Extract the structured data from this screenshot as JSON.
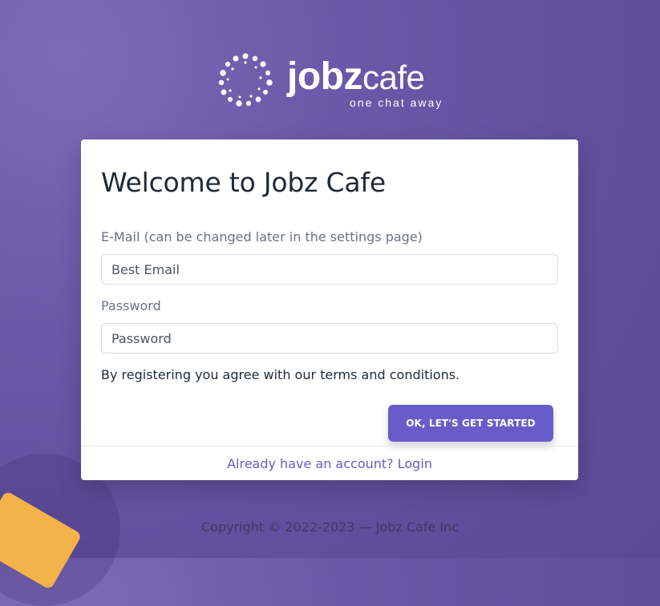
{
  "brand": {
    "name_strong": "jobz",
    "name_light": "cafe",
    "tagline": "one chat away",
    "color_white": "#ffffff"
  },
  "register": {
    "title": "Welcome to Jobz Cafe",
    "email_label": "E-Mail (can be changed later in the settings page)",
    "email_placeholder": "Best Email",
    "password_label": "Password",
    "password_placeholder": "Password",
    "terms_text": "By registering you agree with our terms and conditions.",
    "submit_label": "OK, LET'S GET STARTED",
    "login_link_label": "Already have an account? Login",
    "accent_color": "#6a5cc8"
  },
  "footer": {
    "copyright": "Copyright © 2022-2023 — Jobz Cafe Inc"
  },
  "icons": {
    "logo_mark": "dotted-ring-logo-icon"
  }
}
